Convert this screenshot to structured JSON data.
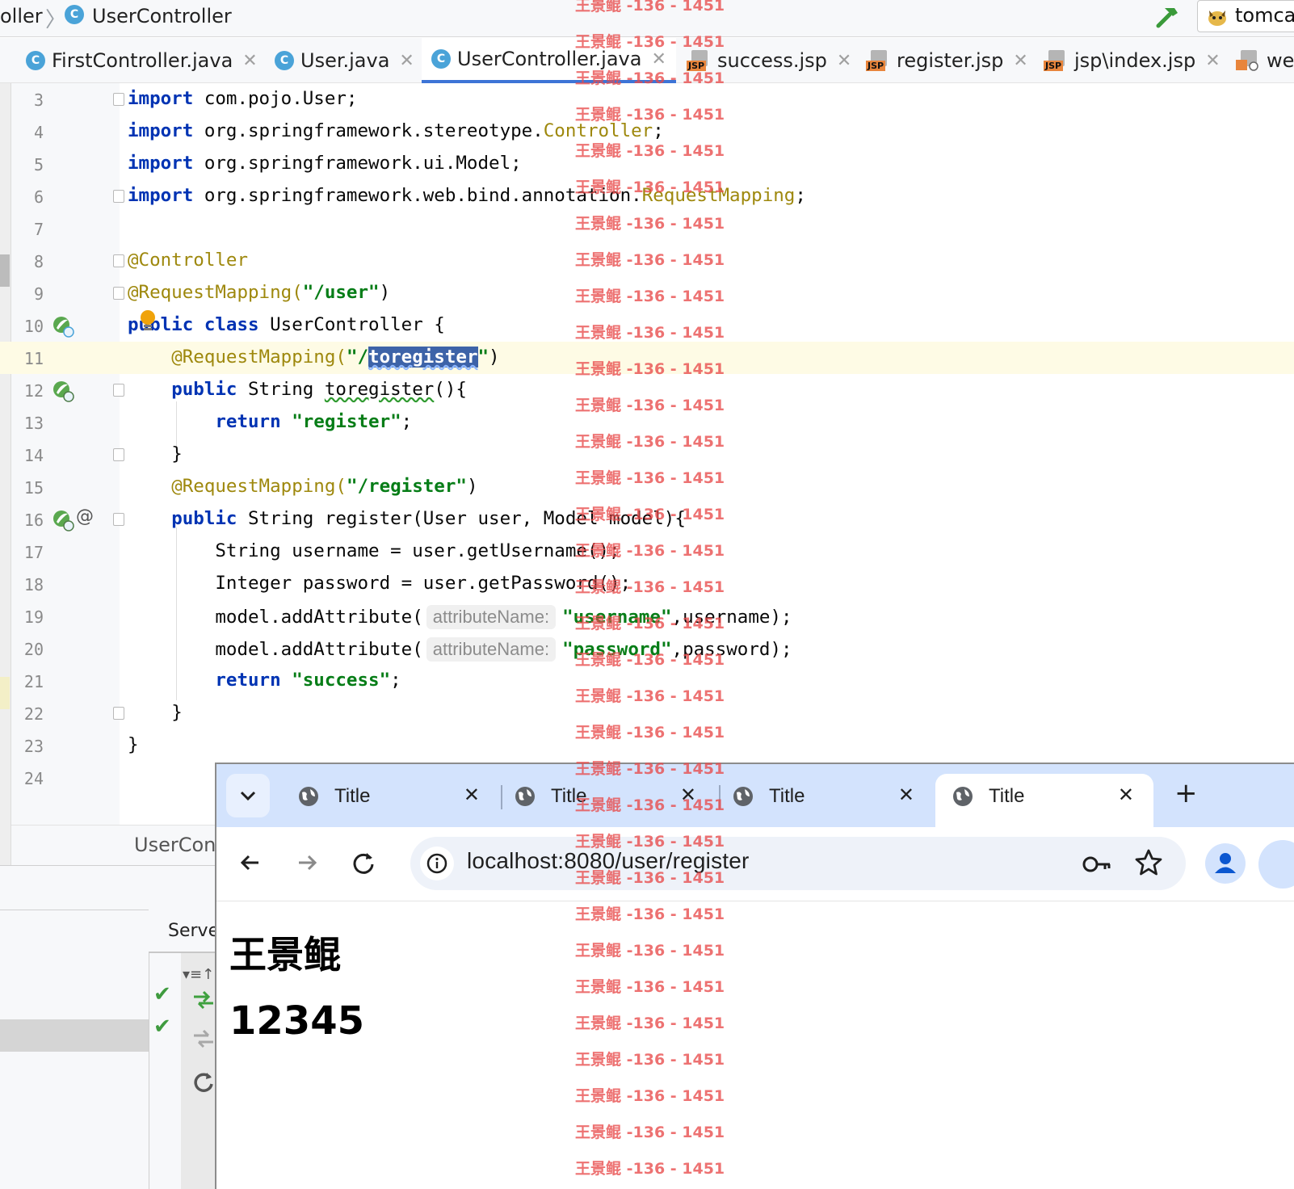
{
  "ide": {
    "breadcrumb_prev": "oller",
    "breadcrumb_current": "UserController",
    "class_icon_letter": "C",
    "run_config": "tomca",
    "tabs": [
      {
        "label": "FirstController.java",
        "icon": "java-class-icon"
      },
      {
        "label": "User.java",
        "icon": "java-class-icon"
      },
      {
        "label": "UserController.java",
        "icon": "java-class-icon",
        "active": true
      },
      {
        "label": "success.jsp",
        "icon": "jsp-icon"
      },
      {
        "label": "register.jsp",
        "icon": "jsp-icon"
      },
      {
        "label": "jsp\\index.jsp",
        "icon": "jsp-icon"
      },
      {
        "label": "wel",
        "icon": "web-xml-icon"
      }
    ],
    "jsp_tag": "JSP",
    "editor_status": "UserCont",
    "tool_tab": "Serve",
    "tool_menu": "▾≡↑"
  },
  "code_lines": [
    {
      "n": "3",
      "text": "import com.pojo.User;"
    },
    {
      "n": "4",
      "text": "import org.springframework.stereotype.Controller;"
    },
    {
      "n": "5",
      "text": "import org.springframework.ui.Model;"
    },
    {
      "n": "6",
      "text": "import org.springframework.web.bind.annotation.RequestMapping;"
    },
    {
      "n": "7",
      "text": ""
    },
    {
      "n": "8",
      "text": "@Controller"
    },
    {
      "n": "9",
      "text": "@RequestMapping(\"/user\")"
    },
    {
      "n": "10",
      "text": "public class UserController {"
    },
    {
      "n": "11",
      "text": "    @RequestMapping(\"/toregister\")"
    },
    {
      "n": "12",
      "text": "    public String toregister(){"
    },
    {
      "n": "13",
      "text": "        return \"register\";"
    },
    {
      "n": "14",
      "text": "    }"
    },
    {
      "n": "15",
      "text": "    @RequestMapping(\"/register\")"
    },
    {
      "n": "16",
      "text": "    public String register(User user, Model model){"
    },
    {
      "n": "17",
      "text": "        String username = user.getUsername();"
    },
    {
      "n": "18",
      "text": "        Integer password = user.getPassword();"
    },
    {
      "n": "19",
      "text": "        model.addAttribute( attributeName: \"username\",username);"
    },
    {
      "n": "20",
      "text": "        model.addAttribute( attributeName: \"password\",password);"
    },
    {
      "n": "21",
      "text": "        return \"success\";"
    },
    {
      "n": "22",
      "text": "    }"
    },
    {
      "n": "23",
      "text": "}"
    },
    {
      "n": "24",
      "text": ""
    }
  ],
  "code_tokens": {
    "l3": [
      "import",
      " com.pojo.User;"
    ],
    "l4": [
      "import",
      " org.springframework.stereotype.",
      "Controller",
      ";"
    ],
    "l5": [
      "import",
      " org.springframework.ui.Model;"
    ],
    "l6": [
      "import",
      " org.springframework.web.bind.annotation.",
      "RequestMapping",
      ";"
    ],
    "l8": [
      "@Controller"
    ],
    "l9": [
      "@RequestMapping(",
      "\"/user\"",
      ")"
    ],
    "l10": [
      "public class",
      " UserController {"
    ],
    "l11": [
      "@RequestMapping(",
      "\"/",
      "toregister",
      "\"",
      ")"
    ],
    "l12": [
      "public",
      " String ",
      "toregister",
      "(){"
    ],
    "l13": [
      "return",
      " ",
      "\"register\"",
      ";"
    ],
    "l14": [
      "}"
    ],
    "l15": [
      "@RequestMapping(",
      "\"/register\"",
      ")"
    ],
    "l16": [
      "public",
      " String register(User user, Model model){"
    ],
    "l17": [
      "String username = user.getUsername();"
    ],
    "l18": [
      "Integer password = user.getPassword();"
    ],
    "l19": [
      "model.addAttribute(",
      "attributeName:",
      "\"username\"",
      ",username);"
    ],
    "l20": [
      "model.addAttribute(",
      "attributeName:",
      "\"password\"",
      ",password);"
    ],
    "l21": [
      "return",
      " ",
      "\"success\"",
      ";"
    ],
    "l22": [
      "}"
    ],
    "l23": [
      "}"
    ]
  },
  "browser": {
    "tabs": [
      {
        "title": "Title",
        "close": "✕"
      },
      {
        "title": "Title",
        "close": "✕"
      },
      {
        "title": "Title",
        "close": "✕"
      },
      {
        "title": "Title",
        "close": "✕",
        "active": true
      }
    ],
    "new_tab": "+",
    "url": "localhost:8080/user/register",
    "page": {
      "username": "王景鲲",
      "password": "12345"
    }
  },
  "watermark": {
    "text": "王景鲲 -136 - 1451"
  },
  "colors": {
    "keyword": "#0033b3",
    "annotation": "#9e880d",
    "string": "#067d17",
    "selection": "#3d63a8",
    "browser_frame": "#d3e3fd",
    "watermark": "#e84a4a"
  }
}
